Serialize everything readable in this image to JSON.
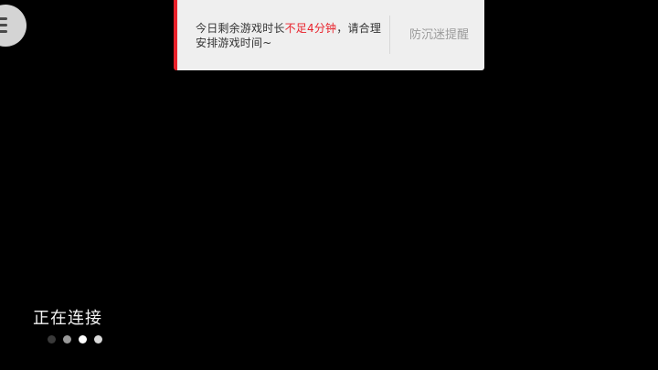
{
  "toast": {
    "message_before": "今日剩余游戏时长",
    "message_highlight": "不足4分钟",
    "message_after": "，请合理安排游戏时间~",
    "action_label": "防沉迷提醒",
    "accent_color": "#e8212a"
  },
  "menu_button": {
    "icon": "menu-icon"
  },
  "status": {
    "text": "正在连接"
  },
  "loading_dots": {
    "colors": [
      "#3a3a3a",
      "#9a9a9a",
      "#ffffff",
      "#d9d9d9"
    ]
  }
}
